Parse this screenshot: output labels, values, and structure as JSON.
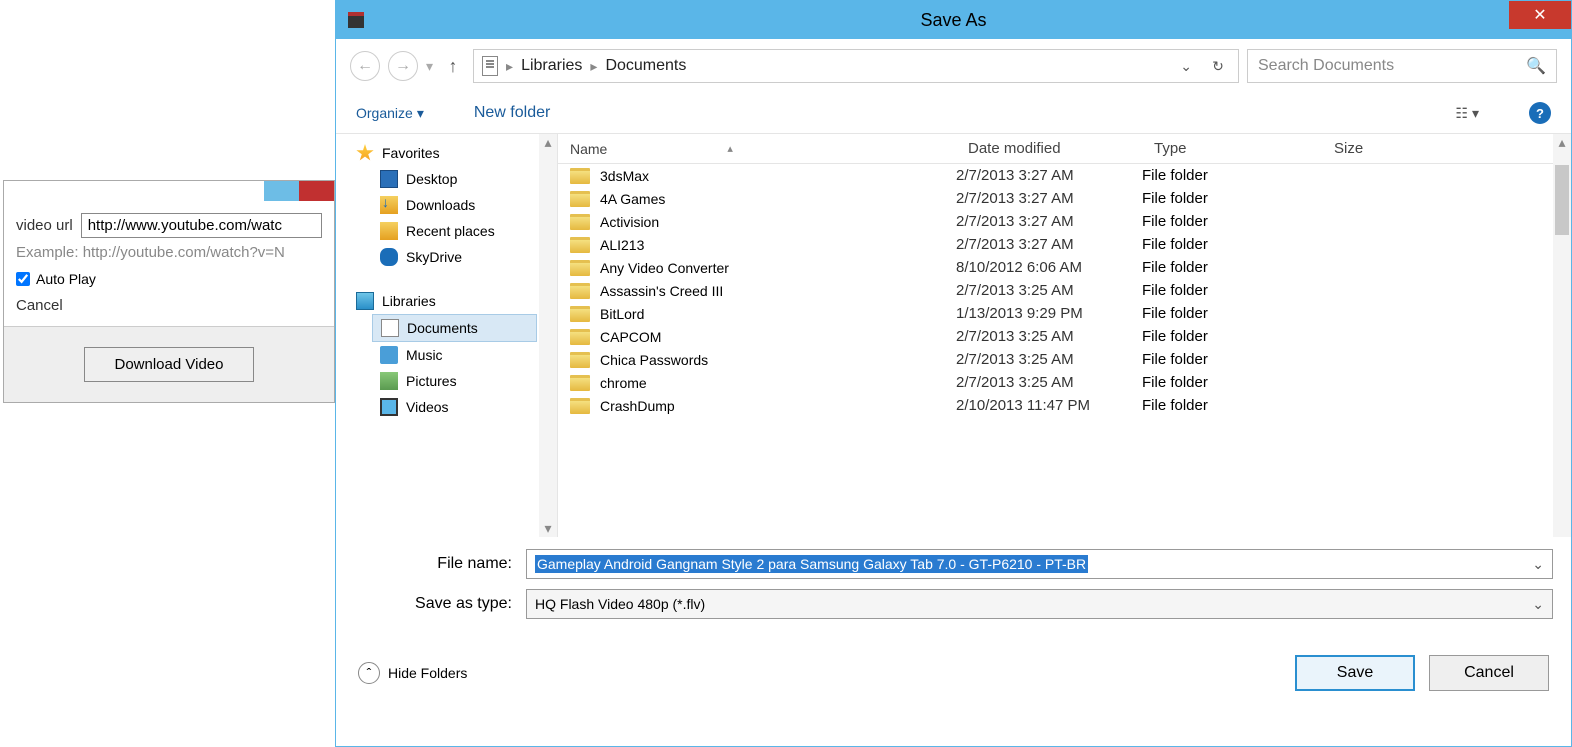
{
  "bg": {
    "url_label": "video url",
    "url_value": "http://www.youtube.com/watc",
    "example": "Example: http://youtube.com/watch?v=N",
    "autoplay": "Auto Play",
    "cancel": "Cancel",
    "download": "Download Video"
  },
  "dialog": {
    "title": "Save As",
    "breadcrumb": [
      "Libraries",
      "Documents"
    ],
    "search_placeholder": "Search Documents",
    "organize": "Organize",
    "new_folder": "New folder",
    "sidebar": {
      "favorites": "Favorites",
      "fav_items": [
        "Desktop",
        "Downloads",
        "Recent places",
        "SkyDrive"
      ],
      "libraries": "Libraries",
      "lib_items": [
        "Documents",
        "Music",
        "Pictures",
        "Videos"
      ]
    },
    "columns": {
      "name": "Name",
      "date": "Date modified",
      "type": "Type",
      "size": "Size"
    },
    "files": [
      {
        "name": "3dsMax",
        "date": "2/7/2013 3:27 AM",
        "type": "File folder"
      },
      {
        "name": "4A Games",
        "date": "2/7/2013 3:27 AM",
        "type": "File folder"
      },
      {
        "name": "Activision",
        "date": "2/7/2013 3:27 AM",
        "type": "File folder"
      },
      {
        "name": "ALI213",
        "date": "2/7/2013 3:27 AM",
        "type": "File folder"
      },
      {
        "name": "Any Video Converter",
        "date": "8/10/2012 6:06 AM",
        "type": "File folder"
      },
      {
        "name": "Assassin's Creed III",
        "date": "2/7/2013 3:25 AM",
        "type": "File folder"
      },
      {
        "name": "BitLord",
        "date": "1/13/2013 9:29 PM",
        "type": "File folder"
      },
      {
        "name": "CAPCOM",
        "date": "2/7/2013 3:25 AM",
        "type": "File folder"
      },
      {
        "name": "Chica Passwords",
        "date": "2/7/2013 3:25 AM",
        "type": "File folder"
      },
      {
        "name": "chrome",
        "date": "2/7/2013 3:25 AM",
        "type": "File folder"
      },
      {
        "name": "CrashDump",
        "date": "2/10/2013 11:47 PM",
        "type": "File folder"
      }
    ],
    "file_name_label": "File name:",
    "file_name_value": "Gameplay Android Gangnam Style 2 para Samsung Galaxy Tab 7.0 - GT-P6210 - PT-BR",
    "type_label": "Save as type:",
    "type_value": "HQ Flash Video 480p (*.flv)",
    "hide_folders": "Hide Folders",
    "save": "Save",
    "cancel": "Cancel"
  }
}
